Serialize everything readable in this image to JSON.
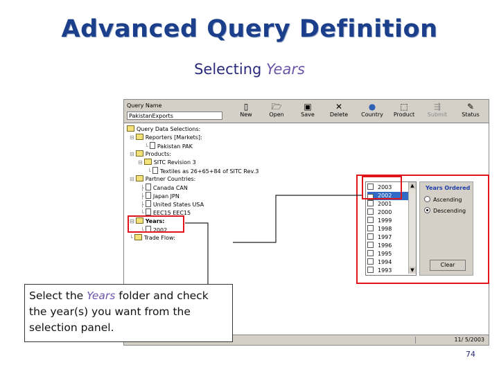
{
  "slide": {
    "title": "Advanced Query Definition",
    "subtitle_prefix": "Selecting ",
    "subtitle_emphasis": "Years",
    "page_number": "74"
  },
  "app": {
    "query_name_label": "Query Name",
    "query_name_value": "PakistanExports",
    "toolbar": [
      {
        "label": "New",
        "icon": "new-icon"
      },
      {
        "label": "Open",
        "icon": "open-folder-icon"
      },
      {
        "label": "Save",
        "icon": "save-disk-icon"
      },
      {
        "label": "Delete",
        "icon": "delete-x-icon"
      },
      {
        "label": "Country",
        "icon": "globe-icon"
      },
      {
        "label": "Product",
        "icon": "product-icon"
      },
      {
        "label": "Submit",
        "icon": "submit-icon"
      },
      {
        "label": "Status",
        "icon": "status-icon"
      }
    ],
    "tree": {
      "root": "Query Data Selections:",
      "reporters": "Reporters [Markets]:",
      "reporter_1": "Pakistan  PAK",
      "products": "Products:",
      "sitc": "SITC Revision 3",
      "textiles": "Textiles as 26+65+84 of SITC Rev.3",
      "partners": "Partner Countries:",
      "partner_1": "Canada  CAN",
      "partner_2": "Japan  JPN",
      "partner_3": "United States  USA",
      "partner_4": "EEC15  EEC15",
      "years": "Years:",
      "year_1": "2002",
      "trade_flow": "Trade Flow:"
    },
    "year_list": [
      {
        "label": "2003",
        "checked": false
      },
      {
        "label": "2002",
        "checked": true
      },
      {
        "label": "2001",
        "checked": false
      },
      {
        "label": "2000",
        "checked": false
      },
      {
        "label": "1999",
        "checked": false
      },
      {
        "label": "1998",
        "checked": false
      },
      {
        "label": "1997",
        "checked": false
      },
      {
        "label": "1996",
        "checked": false
      },
      {
        "label": "1995",
        "checked": false
      },
      {
        "label": "1994",
        "checked": false
      },
      {
        "label": "1993",
        "checked": false
      }
    ],
    "sort_panel": {
      "title": "Years Ordered",
      "ascending": "Ascending",
      "descending": "Descending",
      "selected": "Descending",
      "clear_label": "Clear"
    },
    "status_date": "11/ 5/2003"
  },
  "callout": {
    "prefix": "Select the ",
    "emphasis": "Years",
    "suffix": " folder and check the year(s) you want from the selection panel."
  },
  "colors": {
    "title": "#1b3f8a",
    "highlight": "#e0141b",
    "emphasis": "#6a55aa"
  }
}
